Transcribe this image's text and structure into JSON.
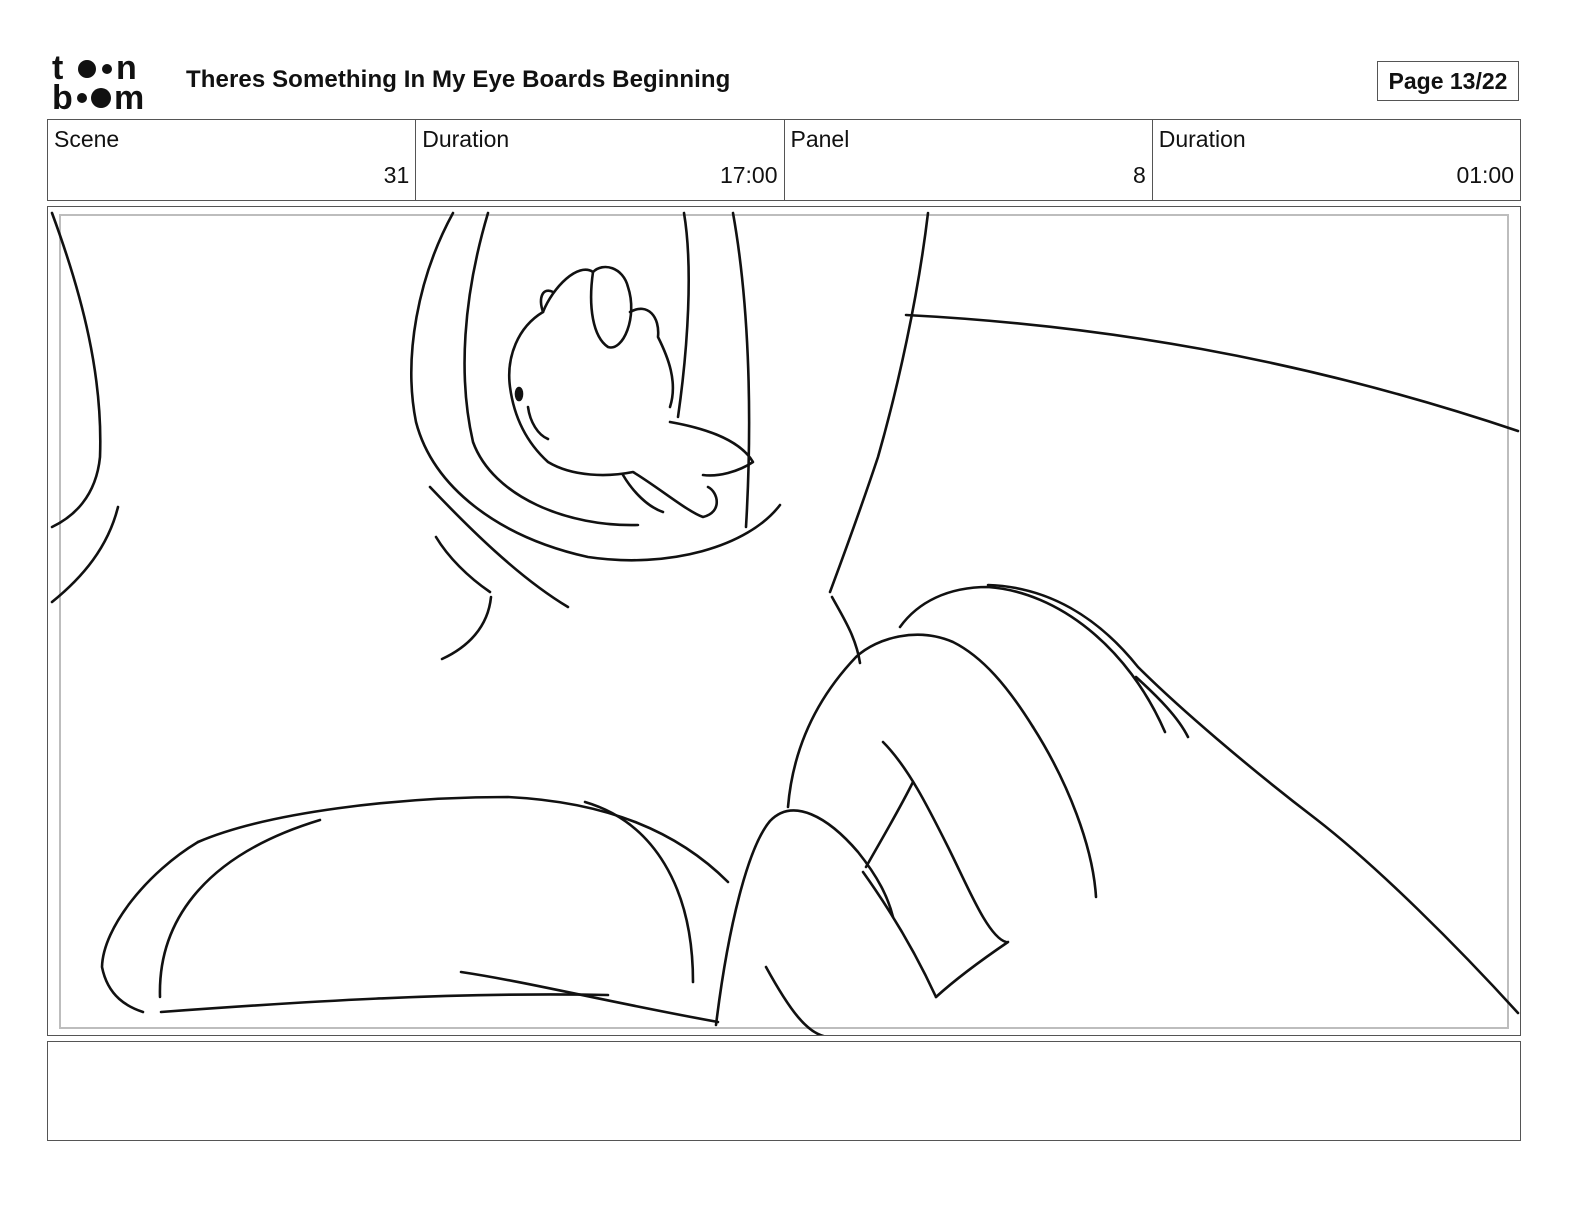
{
  "header": {
    "logo_line1": "toon",
    "logo_line2": "boom",
    "title": "Theres Something In My Eye Boards Beginning",
    "page_label": "Page 13/22"
  },
  "info": [
    {
      "label": "Scene",
      "value": "31"
    },
    {
      "label": "Duration",
      "value": "17:00"
    },
    {
      "label": "Panel",
      "value": "8"
    },
    {
      "label": "Duration",
      "value": "01:00"
    }
  ],
  "notes": {
    "text": ""
  }
}
